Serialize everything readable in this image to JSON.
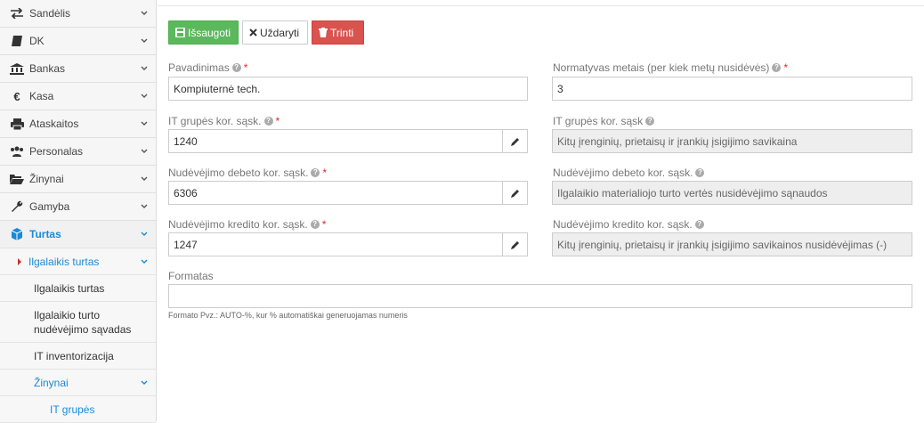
{
  "sidebar": {
    "items": [
      {
        "label": "Sandėlis",
        "icon": "exchange-icon"
      },
      {
        "label": "DK",
        "icon": "book-icon"
      },
      {
        "label": "Bankas",
        "icon": "bank-icon"
      },
      {
        "label": "Kasa",
        "icon": "euro-icon"
      },
      {
        "label": "Ataskaitos",
        "icon": "print-icon"
      },
      {
        "label": "Personalas",
        "icon": "users-icon"
      },
      {
        "label": "Žinynai",
        "icon": "folder-open-icon"
      },
      {
        "label": "Gamyba",
        "icon": "wrench-icon"
      },
      {
        "label": "Turtas",
        "icon": "cube-icon"
      }
    ],
    "sub": {
      "group": "Ilgalaikis turtas",
      "items": [
        "Ilgalaikis turtas",
        "Ilgalaikio turto nudėvėjimo sąvadas",
        "IT inventorizacija"
      ],
      "zinynai": "Žinynai",
      "zinynai_items": [
        "IT grupės"
      ]
    },
    "accent": "#1b8ad6"
  },
  "toolbar": {
    "save": "Išsaugoti",
    "close": "Uždaryti",
    "delete": "Trinti"
  },
  "form": {
    "pavadinimas": {
      "label": "Pavadinimas",
      "value": "Kompiuternė tech."
    },
    "normatyvas": {
      "label": "Normatyvas metais (per kiek metų nusidėvės)",
      "value": "3"
    },
    "it_kor": {
      "label": "IT grupės kor. sąsk.",
      "value": "1240"
    },
    "it_kor_name": {
      "label": "IT grupės kor. sąsk",
      "value": "Kitų įrenginių, prietaisų ir įrankių įsigijimo savikaina"
    },
    "debet": {
      "label": "Nudėvėjimo debeto kor. sąsk.",
      "value": "6306"
    },
    "debet_name": {
      "label": "Nudėvėjimo debeto kor. sąsk.",
      "value": "Ilgalaikio materialiojo turto vertės nusidėvėjimo sąnaudos"
    },
    "kredit": {
      "label": "Nudėvėjimo kredito kor. sąsk.",
      "value": "1247"
    },
    "kredit_name": {
      "label": "Nudėvėjimo kredito kor. sąsk.",
      "value": "Kitų įrenginių, prietaisų ir įrankių įsigijimo savikainos nusidėvėjimas (-)"
    },
    "formatas": {
      "label": "Formatas",
      "value": "",
      "hint": "Formato Pvz.: AUTO-%, kur % automatiškai generuojamas numeris"
    }
  },
  "colors": {
    "save": "#5cb85c",
    "delete": "#d9534f",
    "required": "#e0262d"
  }
}
